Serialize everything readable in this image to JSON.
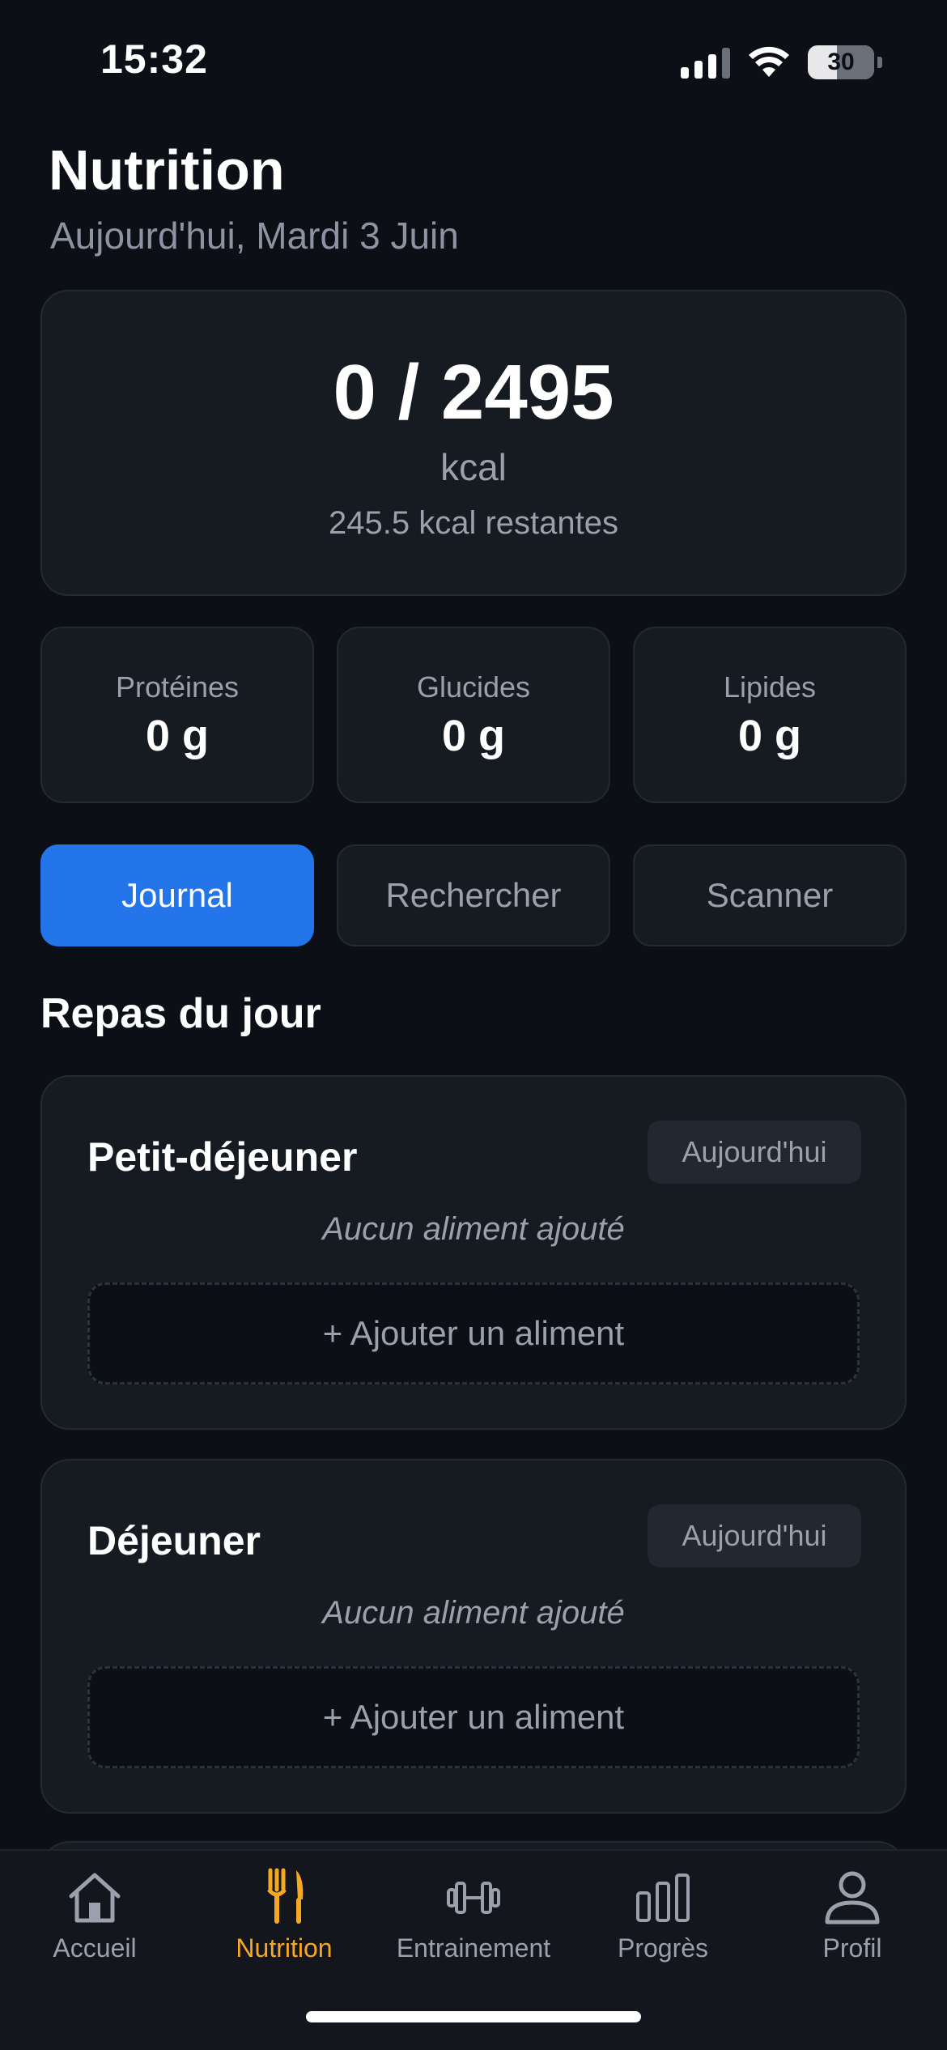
{
  "status_bar": {
    "time": "15:32",
    "battery": "30"
  },
  "header": {
    "title": "Nutrition",
    "subtitle": "Aujourd'hui, Mardi 3 Juin"
  },
  "calories": {
    "value": "0 / 2495",
    "unit": "kcal",
    "remaining": "245.5 kcal restantes"
  },
  "macros": [
    {
      "label": "Protéines",
      "value": "0 g"
    },
    {
      "label": "Glucides",
      "value": "0 g"
    },
    {
      "label": "Lipides",
      "value": "0 g"
    }
  ],
  "tabs": [
    {
      "label": "Journal",
      "active": true
    },
    {
      "label": "Rechercher",
      "active": false
    },
    {
      "label": "Scanner",
      "active": false
    }
  ],
  "section_title": "Repas du jour",
  "meals": [
    {
      "title": "Petit-déjeuner",
      "badge": "Aujourd'hui",
      "empty_text": "Aucun aliment ajouté",
      "add_label": "+ Ajouter un aliment"
    },
    {
      "title": "Déjeuner",
      "badge": "Aujourd'hui",
      "empty_text": "Aucun aliment ajouté",
      "add_label": "+ Ajouter un aliment"
    }
  ],
  "nav": [
    {
      "label": "Accueil",
      "icon": "home-icon",
      "active": false
    },
    {
      "label": "Nutrition",
      "icon": "fork-knife-icon",
      "active": true
    },
    {
      "label": "Entrainement",
      "icon": "dumbbell-icon",
      "active": false
    },
    {
      "label": "Progrès",
      "icon": "bar-chart-icon",
      "active": false
    },
    {
      "label": "Profil",
      "icon": "user-icon",
      "active": false
    }
  ],
  "colors": {
    "accent_blue": "#2474ea",
    "accent_orange": "#f7a823",
    "background": "#0c0f15",
    "card": "#161a21"
  }
}
